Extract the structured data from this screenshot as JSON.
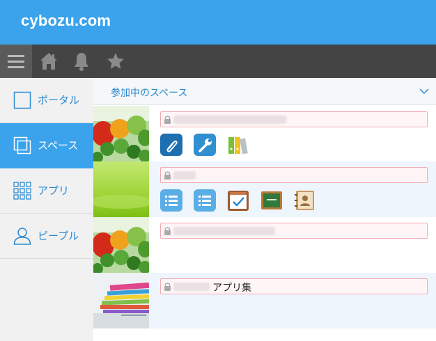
{
  "header": {
    "logo": "cybozu.com"
  },
  "toolbar": {
    "icons": [
      "menu-icon",
      "home-icon",
      "bell-icon",
      "star-icon"
    ]
  },
  "sidebar": {
    "items": [
      {
        "label": "ポータル",
        "icon": "portal-icon",
        "active": false
      },
      {
        "label": "スペース",
        "icon": "space-icon",
        "active": true
      },
      {
        "label": "アプリ",
        "icon": "apps-grid-icon",
        "active": false
      },
      {
        "label": "ピープル",
        "icon": "person-icon",
        "active": false
      }
    ]
  },
  "main": {
    "section_title": "参加中のスペース",
    "spaces": [
      {
        "name": "",
        "thumbnail": "vegetables",
        "apps": [
          "paperclip-app-icon",
          "wrench-app-icon",
          "binders-app-icon"
        ]
      },
      {
        "name": "",
        "thumbnail": "green-gradient",
        "apps": [
          "list-app-icon",
          "list-app-icon",
          "calendar-check-app-icon",
          "chalkboard-app-icon",
          "address-book-app-icon"
        ]
      },
      {
        "name": "",
        "thumbnail": "vegetables",
        "apps": []
      },
      {
        "name": "アプリ集",
        "thumbnail": "books",
        "apps": []
      }
    ]
  },
  "colors": {
    "header": "#3aa3ec",
    "toolbar": "#444444",
    "accent_text": "#2a8ad0",
    "active_nav": "#3aa3ec",
    "row_alt": "#eef5fd",
    "name_border": "#f2aab0"
  }
}
